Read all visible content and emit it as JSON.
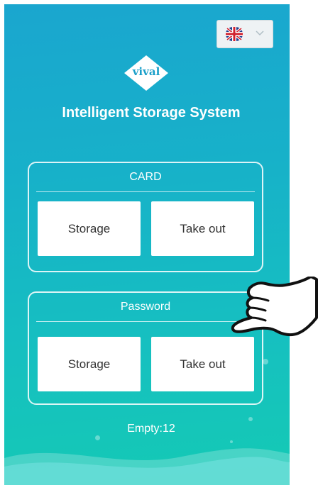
{
  "header": {
    "language": {
      "selected": "English (UK)",
      "flag_icon": "uk-flag-icon"
    },
    "brand": "vival",
    "title": "Intelligent Storage System"
  },
  "card_section": {
    "heading": "CARD",
    "storage_label": "Storage",
    "take_out_label": "Take out"
  },
  "password_section": {
    "heading": "Password",
    "storage_label": "Storage",
    "take_out_label": "Take out"
  },
  "status": {
    "empty_text": "Empty:12"
  },
  "colors": {
    "gradient_top": "#1aa6cf",
    "gradient_bottom": "#14cab4",
    "button_bg": "#ffffff",
    "text_white": "#ffffff"
  }
}
